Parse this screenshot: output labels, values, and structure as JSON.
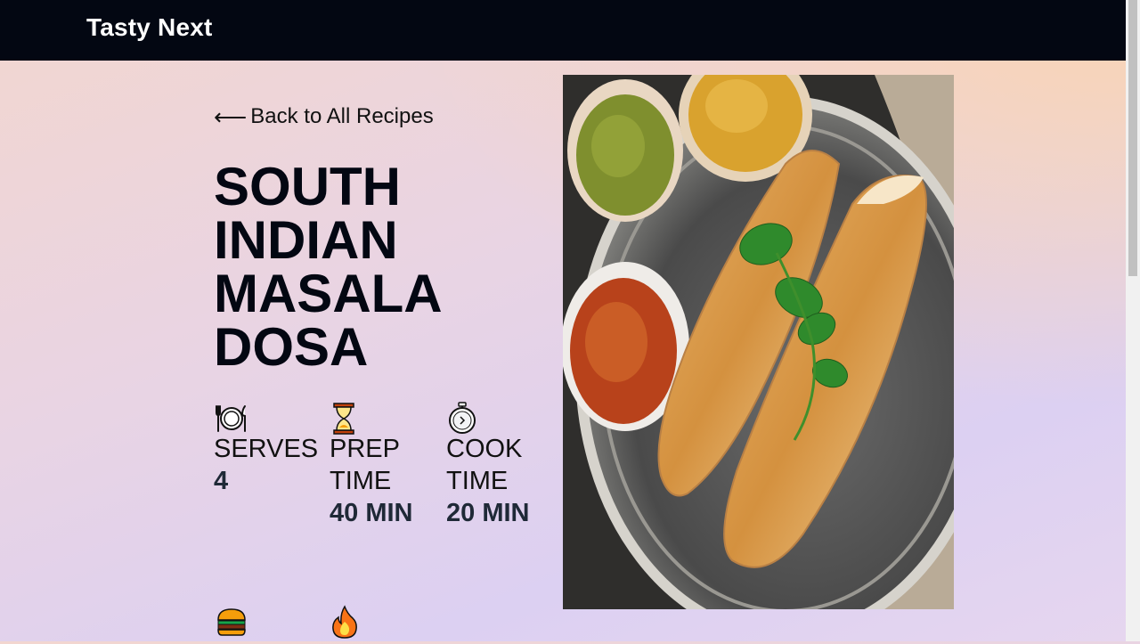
{
  "navbar": {
    "brand": "Tasty Next"
  },
  "back_link": {
    "arrow": "⟵",
    "label": "Back to All Recipes"
  },
  "recipe": {
    "title": "South Indian Masala Dosa",
    "stats": {
      "serves": {
        "icon": "plate-cutlery-icon",
        "label": "SERVES",
        "value": "4"
      },
      "prep": {
        "icon": "hourglass-icon",
        "label": "PREP TIME",
        "value": "40 MIN"
      },
      "cook": {
        "icon": "stopwatch-icon",
        "label": "COOK TIME",
        "value": "20 MIN"
      }
    },
    "more_stat_icons": [
      "burger-icon",
      "flame-icon"
    ],
    "image": {
      "subject": "dosa-plate-image"
    }
  },
  "colors": {
    "navbar": "#030712",
    "title": "#030712",
    "value": "#1f2937"
  }
}
